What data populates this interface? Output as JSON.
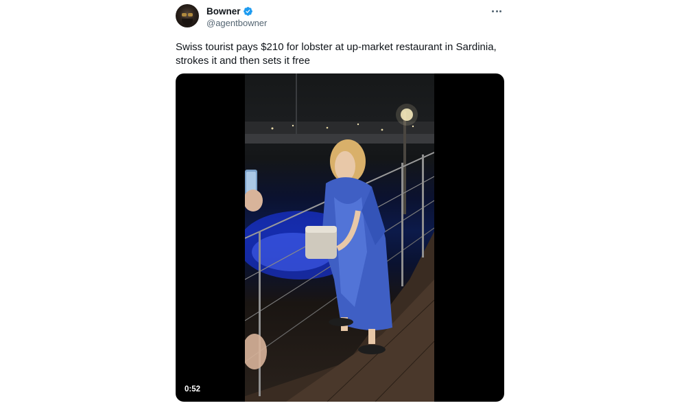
{
  "author": {
    "name": "Bowner",
    "handle": "@agentbowner",
    "verified": true,
    "verified_color": "#1d9bf0"
  },
  "icons": {
    "avatar": "profile-photo",
    "verified": "verified-badge-icon",
    "more": "more-options-icon"
  },
  "tweet": {
    "text": "Swiss tourist pays $210 for lobster at up-market restaurant in Sardinia,\nstrokes it and then sets it free"
  },
  "media": {
    "type": "video",
    "duration": "0:52"
  }
}
